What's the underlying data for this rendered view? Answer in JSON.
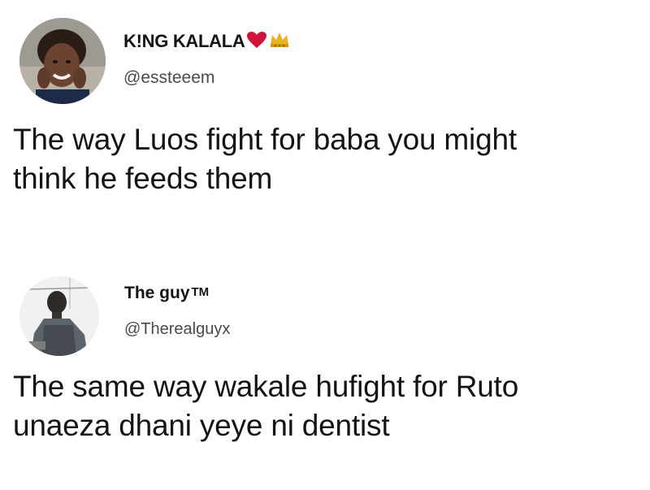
{
  "tweets": [
    {
      "author": {
        "display_name": "K!NG KALALA",
        "handle": "@essteeem",
        "badges": [
          "heart-emoji",
          "crown-emoji"
        ]
      },
      "text_lines": [
        "The way Luos fight for baba you might",
        "think he feeds them"
      ]
    },
    {
      "author": {
        "display_name": "The guy",
        "trademark": "TM",
        "handle": "@Therealguyx"
      },
      "text_lines": [
        "The same way wakale hufight for Ruto",
        "unaeza dhani yeye ni dentist"
      ]
    }
  ],
  "colors": {
    "text": "#141414",
    "handle": "#4a4a4a",
    "heart": "#d3123a",
    "crown": "#e8b520"
  }
}
